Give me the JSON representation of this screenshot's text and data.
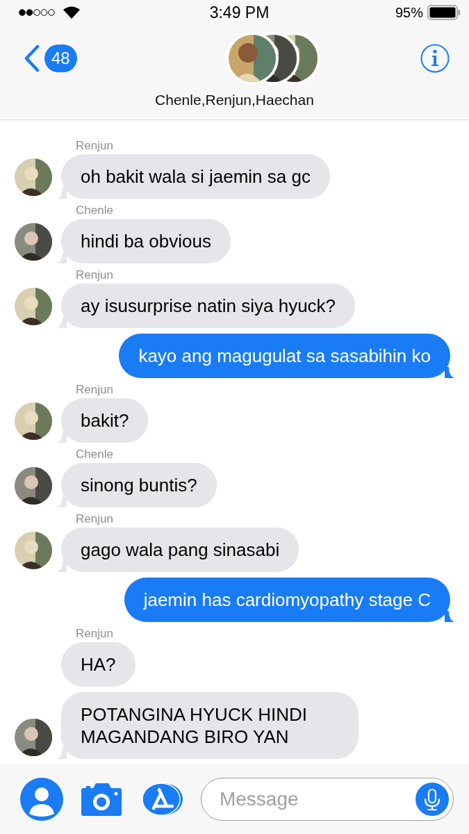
{
  "status_bar": {
    "time": "3:49 PM",
    "battery": "95%"
  },
  "header": {
    "back_count": "48",
    "title": "Chenle,Renjun,Haechan"
  },
  "messages": [
    {
      "kind": "incoming",
      "sender": "Renjun",
      "text": "oh bakit wala si jaemin sa gc",
      "tail": true
    },
    {
      "kind": "incoming",
      "sender": "Chenle",
      "text": "hindi ba obvious",
      "tail": true
    },
    {
      "kind": "incoming",
      "sender": "Renjun",
      "text": "ay isusurprise natin siya hyuck?",
      "tail": true
    },
    {
      "kind": "outgoing",
      "text": "kayo ang magugulat sa sasabihin ko",
      "tail": true
    },
    {
      "kind": "incoming",
      "sender": "Renjun",
      "text": "bakit?",
      "tail": true
    },
    {
      "kind": "incoming",
      "sender": "Chenle",
      "text": "sinong buntis?",
      "tail": true
    },
    {
      "kind": "incoming",
      "sender": "Renjun",
      "text": "gago wala pang sinasabi",
      "tail": true
    },
    {
      "kind": "outgoing",
      "text": "jaemin has cardiomyopathy stage C",
      "tail": true
    },
    {
      "kind": "incoming",
      "sender": "Renjun",
      "text": "HA?",
      "tail": false
    },
    {
      "kind": "incoming",
      "text": "POTANGINA HYUCK HINDI MAGANDANG BIRO YAN",
      "tail": true
    }
  ],
  "composer": {
    "placeholder": "Message"
  }
}
